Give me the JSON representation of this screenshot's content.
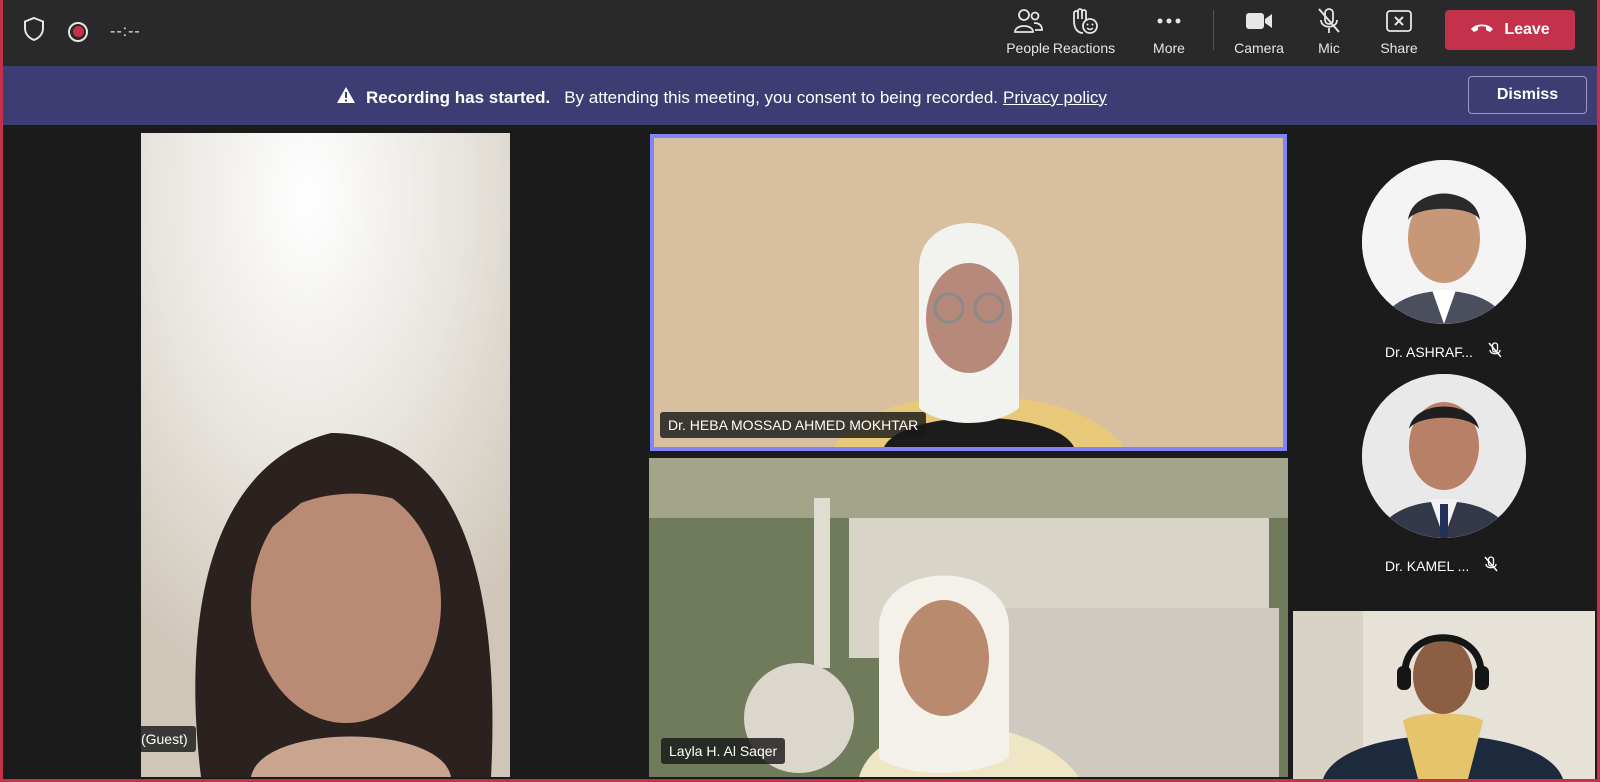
{
  "topbar": {
    "timer": "--:--",
    "tools": [
      {
        "label": "People",
        "icon": "people-icon"
      },
      {
        "label": "Reactions",
        "icon": "reactions-icon"
      },
      {
        "label": "More",
        "icon": "more-icon"
      },
      {
        "label": "Camera",
        "icon": "camera-icon"
      },
      {
        "label": "Mic",
        "icon": "mic-off-icon"
      },
      {
        "label": "Share",
        "icon": "share-icon"
      }
    ],
    "leave_label": "Leave"
  },
  "banner": {
    "title": "Recording has started.",
    "message": "By attending this meeting, you consent to being recorded.",
    "link": "Privacy policy",
    "dismiss_label": "Dismiss"
  },
  "participants": {
    "left_tile": "Howayda Mostafa (Guest)",
    "featured_tile": "Dr. HEBA MOSSAD AHMED MOKHTAR",
    "lower_tile": "Layla H. Al Saqer",
    "avatar_1": "Dr. ASHRAF...",
    "avatar_2": "Dr. KAMEL ..."
  },
  "colors": {
    "leave": "#c4314b",
    "banner": "#3d3d73",
    "active_speaker_border": "#7f85f5"
  }
}
